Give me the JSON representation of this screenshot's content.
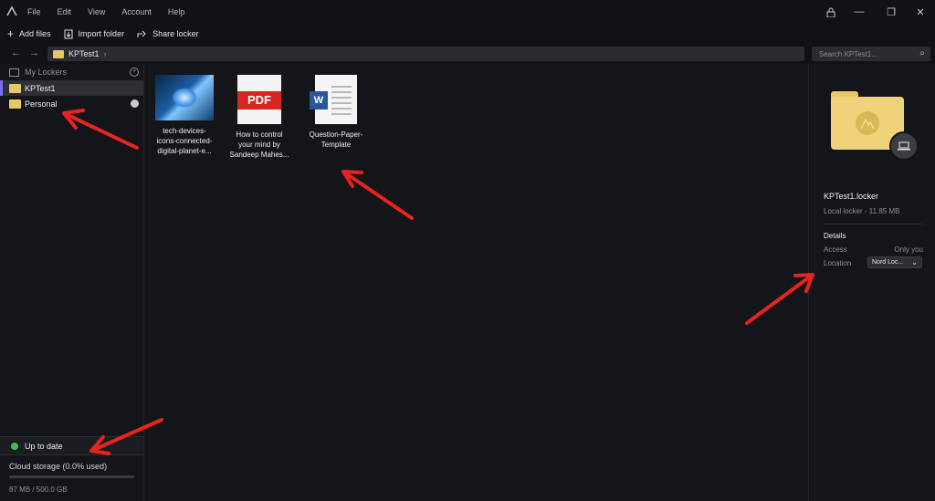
{
  "menu": [
    "File",
    "Edit",
    "View",
    "Account",
    "Help"
  ],
  "window_controls": {
    "lock": "🔒",
    "minimize": "—",
    "restore": "❐",
    "close": "✕"
  },
  "toolbar": {
    "add_files": "Add files",
    "import_folder": "Import folder",
    "share_locker": "Share locker"
  },
  "nav": {
    "back": "←",
    "forward": "→"
  },
  "breadcrumb": {
    "current": "KPTest1",
    "chevron": "›"
  },
  "search": {
    "placeholder": "Search KPTest1..."
  },
  "sidebar": {
    "header": "My Lockers",
    "items": [
      {
        "label": "KPTest1",
        "active": true
      },
      {
        "label": "Personal",
        "active": false
      }
    ]
  },
  "status": {
    "text": "Up to date",
    "color": "#3bbf5a"
  },
  "storage": {
    "label": "Cloud storage (0.0% used)",
    "used_fraction": 0.0,
    "size": "87 MB / 500.0 GB"
  },
  "files": [
    {
      "name_lines": [
        "tech-devices-",
        "icons-connected-",
        "digital-planet-e..."
      ],
      "type": "image"
    },
    {
      "name_lines": [
        "How to control",
        "your mind by",
        "Sandeep Mahes..."
      ],
      "type": "pdf",
      "badge": "PDF"
    },
    {
      "name_lines": [
        "Question-Paper-",
        "Template"
      ],
      "type": "word",
      "badge": "W"
    }
  ],
  "details": {
    "title": "KPTest1.locker",
    "subtitle": "Local locker - 11.85 MB",
    "section": "Details",
    "access_label": "Access",
    "access_value": "Only you",
    "location_label": "Location",
    "location_value": "Nord Loc..."
  },
  "colors": {
    "accent": "#7a6df0",
    "folder": "#e8c766",
    "annotation_arrow": "#e8231e"
  }
}
